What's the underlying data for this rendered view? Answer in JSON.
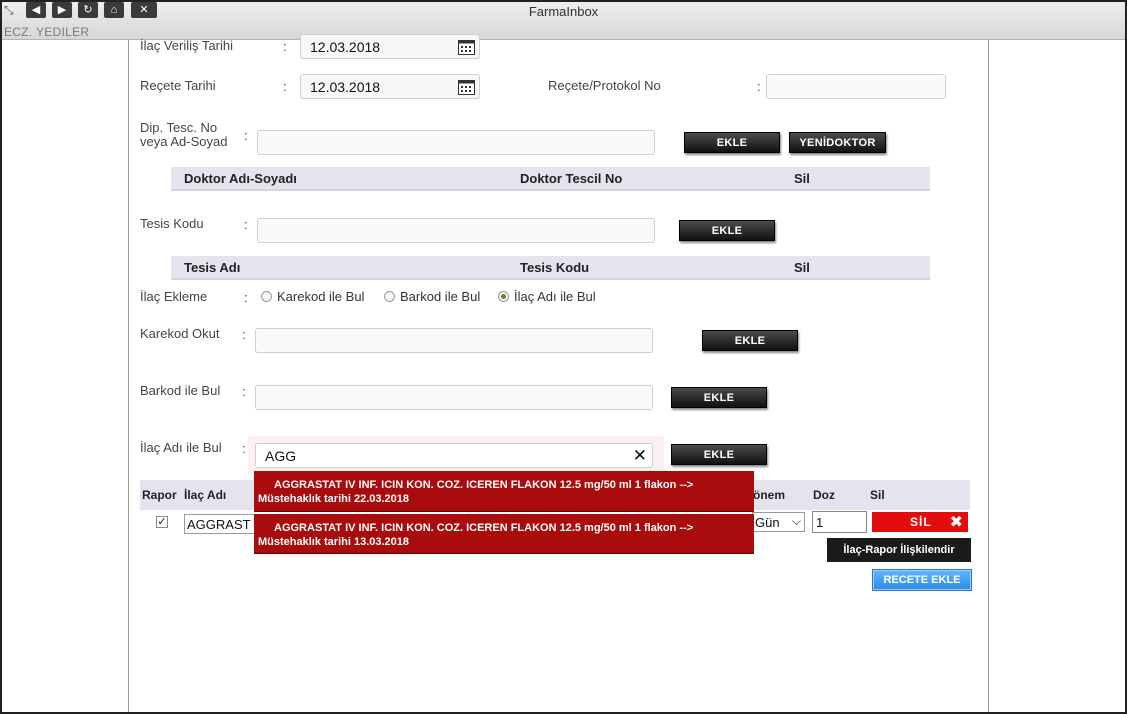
{
  "window": {
    "title": "FarmaInbox",
    "user": "ECZ. YEDILER"
  },
  "form": {
    "ilac_verilis": {
      "label": "İlaç Veriliş Tarihi",
      "value": "12.03.2018"
    },
    "recete_tarihi": {
      "label": "Reçete Tarihi",
      "value": "12.03.2018"
    },
    "protokol": {
      "label": "Reçete/Protokol No",
      "value": ""
    },
    "doktor": {
      "label_line1": "Dip. Tesc. No",
      "label_line2": "veya Ad-Soyad",
      "value": "",
      "add_label": "EKLE",
      "new_label": "YENİDOKTOR"
    },
    "doktor_table": {
      "col1": "Doktor Adı-Soyadı",
      "col2": "Doktor Tescil No",
      "col3": "Sil"
    },
    "tesis": {
      "label": "Tesis Kodu",
      "value": "",
      "add_label": "EKLE"
    },
    "tesis_table": {
      "col1": "Tesis Adı",
      "col2": "Tesis Kodu",
      "col3": "Sil"
    },
    "ilac_ekleme": {
      "label": "İlaç Ekleme",
      "options": [
        "Karekod ile Bul",
        "Barkod ile Bul",
        "İlaç Adı ile Bul"
      ],
      "selected": "İlaç Adı ile Bul"
    },
    "karekod": {
      "label": "Karekod Okut",
      "value": "",
      "add_label": "EKLE"
    },
    "barkod": {
      "label": "Barkod ile Bul",
      "value": "",
      "add_label": "EKLE"
    },
    "ilac_adi": {
      "label": "İlaç Adı ile Bul",
      "value": "AGG",
      "add_label": "EKLE"
    },
    "colon": ":"
  },
  "autocomplete": [
    {
      "line1": "AGGRASTAT IV INF. ICIN KON. COZ. ICEREN FLAKON 12.5 mg/50 ml 1 flakon -->",
      "line2": "Müstehaklık tarihi 22.03.2018"
    },
    {
      "line1": "AGGRASTAT IV INF. ICIN KON. COZ. ICEREN FLAKON 12.5 mg/50 ml 1 flakon -->",
      "line2": "Müstehaklık tarihi 13.03.2018"
    }
  ],
  "drug_table": {
    "headers": {
      "rapor": "Rapor",
      "ilac_adi": "İlaç Adı",
      "donem": "önem",
      "doz": "Doz",
      "sil": "Sil"
    },
    "row": {
      "rapor_checked": true,
      "ilac_adi": "AGGRAST",
      "donem": "Gün",
      "doz": "1",
      "sil_label": "SİL"
    }
  },
  "buttons": {
    "ilac_rapor": "İlaç-Rapor İlişkilendir",
    "recete_ekle": "RECETE EKLE"
  },
  "colors": {
    "danger": "#e40d0d",
    "autocomplete_bg": "#a80c0c",
    "primary": "#2d8be6"
  }
}
